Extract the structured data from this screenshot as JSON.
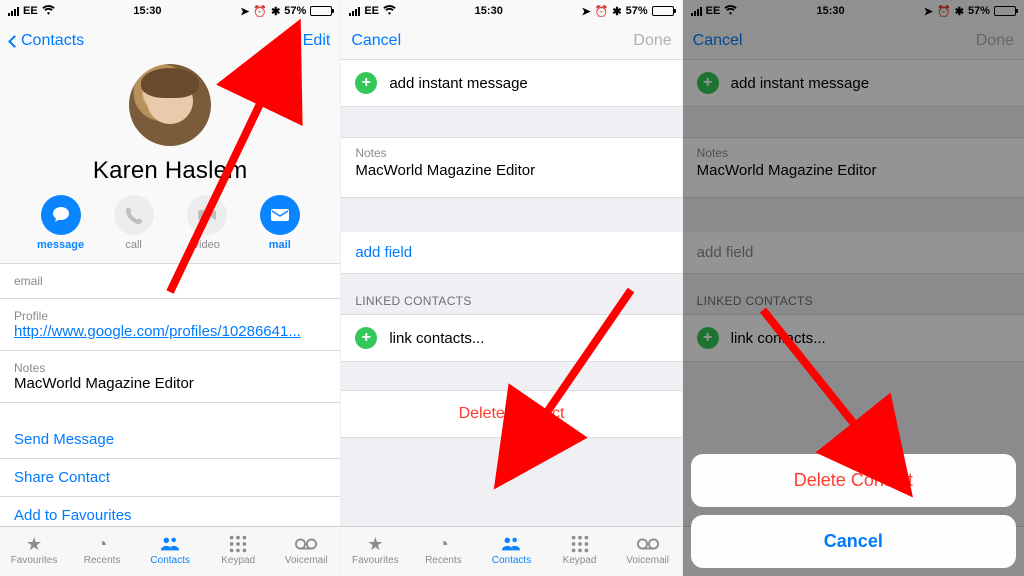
{
  "statusbar": {
    "carrier": "EE",
    "time": "15:30",
    "battery_pct": "57%"
  },
  "screen1": {
    "back_label": "Contacts",
    "edit_label": "Edit",
    "contact_name": "Karen Haslem",
    "actions": {
      "message": "message",
      "call": "call",
      "video": "video",
      "mail": "mail"
    },
    "email_label": "email",
    "profile_label": "Profile",
    "profile_url": "http://www.google.com/profiles/10286641...",
    "notes_label": "Notes",
    "notes_value": "MacWorld Magazine Editor",
    "send_message": "Send Message",
    "share_contact": "Share Contact",
    "add_favourites": "Add to Favourites"
  },
  "screen2": {
    "cancel": "Cancel",
    "done": "Done",
    "add_im": "add instant message",
    "notes_label": "Notes",
    "notes_value": "MacWorld Magazine Editor",
    "add_field": "add field",
    "linked_header": "LINKED CONTACTS",
    "link_contacts": "link contacts...",
    "delete_contact": "Delete Contact"
  },
  "screen3": {
    "cancel": "Cancel",
    "done": "Done",
    "add_im": "add instant message",
    "notes_label": "Notes",
    "notes_value": "MacWorld Magazine Editor",
    "add_field": "add field",
    "linked_header": "LINKED CONTACTS",
    "link_contacts": "link contacts...",
    "sheet_delete": "Delete Contact",
    "sheet_cancel": "Cancel"
  },
  "tabs": {
    "favourites": "Favourites",
    "recents": "Recents",
    "contacts": "Contacts",
    "keypad": "Keypad",
    "voicemail": "Voicemail"
  },
  "colors": {
    "ios_blue": "#007aff",
    "ios_red": "#ff3b30",
    "ios_green": "#34c759",
    "arrow_red": "#ff0000"
  }
}
